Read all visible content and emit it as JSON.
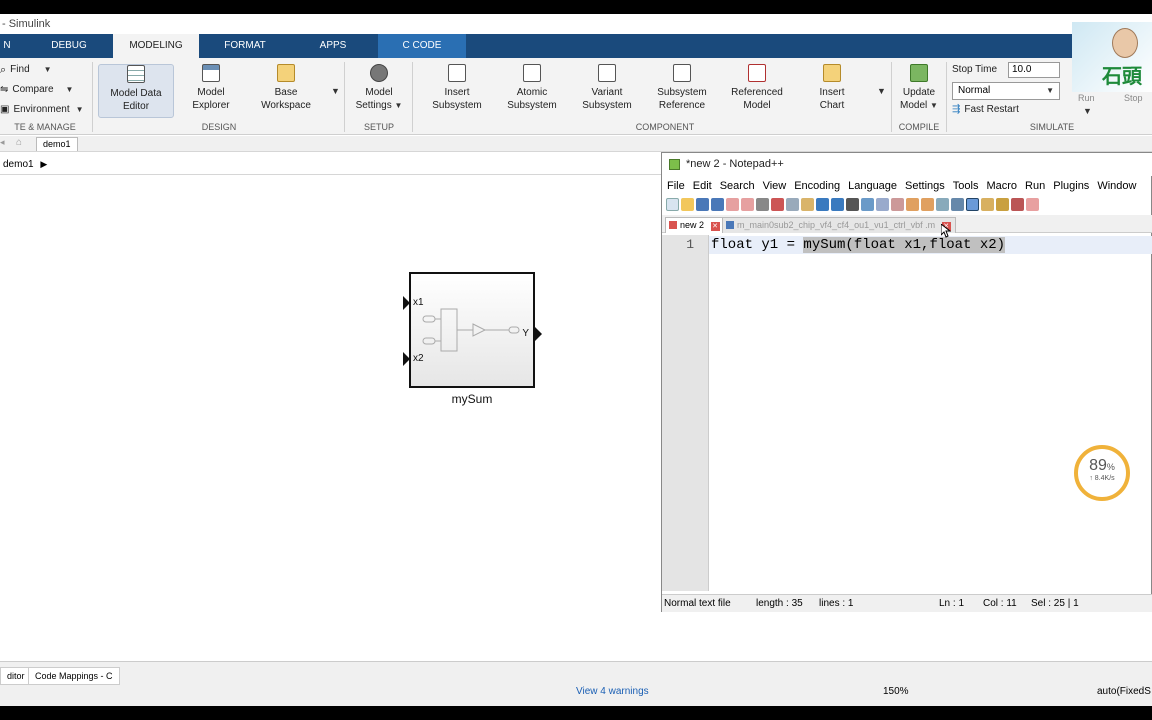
{
  "window": {
    "title": "- Simulink"
  },
  "tabs": [
    "N",
    "DEBUG",
    "MODELING",
    "FORMAT",
    "APPS",
    "C CODE"
  ],
  "ribbon": {
    "find": "Find",
    "compare": "Compare",
    "environment": "Environment",
    "groups": [
      "TE & MANAGE",
      "DESIGN",
      "SETUP",
      "COMPONENT",
      "COMPILE",
      "SIMULATE"
    ],
    "model_data_editor": [
      "Model Data",
      "Editor"
    ],
    "model_explorer": [
      "Model",
      "Explorer"
    ],
    "base_workspace": [
      "Base",
      "Workspace"
    ],
    "model_settings": [
      "Model",
      "Settings"
    ],
    "insert_subsystem": [
      "Insert",
      "Subsystem"
    ],
    "atomic_subsystem": [
      "Atomic",
      "Subsystem"
    ],
    "variant_subsystem": [
      "Variant",
      "Subsystem"
    ],
    "subsystem_reference": [
      "Subsystem",
      "Reference"
    ],
    "referenced_model": [
      "Referenced",
      "Model"
    ],
    "insert_chart": [
      "Insert",
      "Chart"
    ],
    "update_model": [
      "Update",
      "Model"
    ],
    "stop_time_label": "Stop Time",
    "stop_time_value": "10.0",
    "sim_mode": "Normal",
    "fast_restart": "Fast Restart",
    "run": "Run",
    "stop": "Stop"
  },
  "doc_tab": "demo1",
  "breadcrumb": "demo1",
  "block": {
    "name": "mySum",
    "inputs": [
      "x1",
      "x2"
    ],
    "output": "Y"
  },
  "bottom": {
    "tabs": [
      "ditor",
      "Code Mappings - C"
    ],
    "warnings": "View 4 warnings",
    "zoom": "150%",
    "solver": "auto(FixedS"
  },
  "notepad": {
    "title": "*new 2 - Notepad++",
    "menu": [
      "File",
      "Edit",
      "Search",
      "View",
      "Encoding",
      "Language",
      "Settings",
      "Tools",
      "Macro",
      "Run",
      "Plugins",
      "Window"
    ],
    "tabs": [
      "new 2",
      "m_main0sub2_chip_vf4_cf4_ou1_vu1_ctrl_vbf .m"
    ],
    "line_number": "1",
    "code_prefix": "float y1 = ",
    "code_selected": "mySum(float x1,float x2)",
    "status": {
      "filetype": "Normal text file",
      "length": "length : 35",
      "lines": "lines : 1",
      "ln": "Ln : 1",
      "col": "Col : 11",
      "sel": "Sel : 25 | 1"
    }
  },
  "overlay": {
    "gauge_percent": "89",
    "gauge_unit": "%",
    "gauge_speed": "↑ 8.4K/s",
    "avatar_text": "石頭"
  },
  "colors": {
    "tab_bar": "#1a4a7c",
    "c_code_tab": "#2a6fb3",
    "gauge_ring": "#f0b23a"
  }
}
